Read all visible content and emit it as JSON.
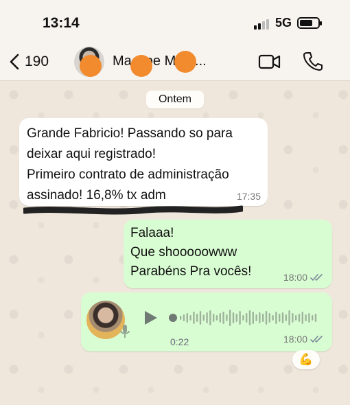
{
  "status_bar": {
    "time": "13:14",
    "network": "5G"
  },
  "header": {
    "back_count": "190",
    "contact_name": "Ma Coe Ment..."
  },
  "chat": {
    "date_divider": "Ontem",
    "messages": [
      {
        "direction": "incoming",
        "text": "Grande Fabricio! Passando so para\ndeixar aqui registrado!\nPrimeiro contrato de administração\nassinado! 16,8% tx adm",
        "time": "17:35"
      },
      {
        "direction": "outgoing",
        "text": "Falaaa!\nQue shooooowww\nParabéns Pra vocês!",
        "time": "18:00",
        "status": "read"
      },
      {
        "direction": "outgoing",
        "type": "voice",
        "duration": "0:22",
        "time": "18:00",
        "status": "read",
        "reaction": "💪"
      }
    ]
  },
  "colors": {
    "incoming_bubble": "#ffffff",
    "outgoing_bubble": "#d9fdd3",
    "read_ticks": "#7a8a96",
    "redaction": "#f28a2e"
  }
}
